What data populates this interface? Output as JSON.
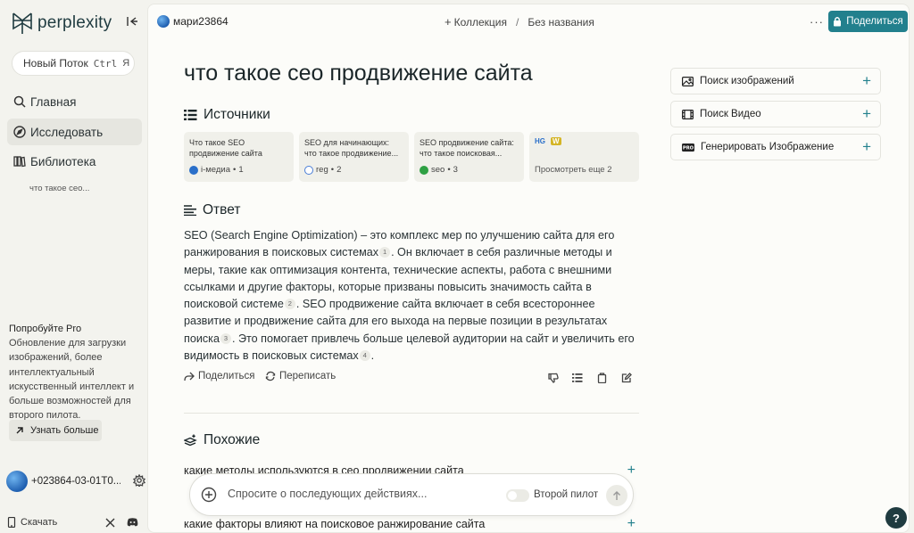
{
  "brand": {
    "name": "perplexity"
  },
  "sidebar": {
    "new_thread": {
      "label": "Новый Поток",
      "kbd1": "Ctrl",
      "kbd2": "Я"
    },
    "nav": [
      {
        "label": "Главная",
        "icon": "search-icon"
      },
      {
        "label": "Исследовать",
        "icon": "compass-icon"
      },
      {
        "label": "Библиотека",
        "icon": "library-icon"
      }
    ],
    "library_item": "что такое сео...",
    "promo": {
      "title": "Попробуйте Pro",
      "text": "Обновление для загрузки изображений, более интеллектуальный искусственный интеллект и больше возможностей для второго пилота.",
      "button": "Узнать больше"
    },
    "user": "+023864-03-01T0...",
    "download": "Скачать"
  },
  "topbar": {
    "user": "мари23864",
    "collection": "Коллекция",
    "separator": "/",
    "thread_name": "Без названия",
    "more": "···",
    "share": "Поделиться"
  },
  "thread": {
    "question": "что такое сео продвижение сайта",
    "sources_heading": "Источники",
    "sources": [
      {
        "title": "Что такое SEO продвижение сайта",
        "site": "i-медиа",
        "num": "1",
        "fav_color": "#2a6fc9"
      },
      {
        "title": "SEO для начинающих: что такое продвижение...",
        "site": "reg",
        "num": "2",
        "fav_color": "#4a7ed6"
      },
      {
        "title": "SEO продвижение сайта: что такое поисковая...",
        "site": "seo",
        "num": "3",
        "fav_color": "#2ea043"
      }
    ],
    "more_sources": {
      "label": "Просмотреть еще 2",
      "badge1": "HG",
      "badge2": "W"
    },
    "answer_heading": "Ответ",
    "answer": [
      {
        "t": "SEO (Search Engine Optimization) – это комплекс мер по улучшению сайта для его ранжирования в поисковых системах",
        "c": "1"
      },
      {
        "t": ". Он включает в себя различные методы и меры, такие как оптимизация контента, технические аспекты, работа с внешними ссылками и другие факторы, которые призваны повысить значимость сайта в поисковой системе",
        "c": "2"
      },
      {
        "t": ". SEO продвижение сайта включает в себя всестороннее развитие и продвижение сайта для его выхода на первые позиции в результатах поиска",
        "c": "3"
      },
      {
        "t": ". Это помогает привлечь больше целевой аудитории на сайт и увеличить его видимость в поисковых системах",
        "c": "4"
      },
      {
        "t": ".",
        "c": null
      }
    ],
    "actions": {
      "share": "Поделиться",
      "rewrite": "Переписать"
    },
    "related_heading": "Похожие",
    "related": [
      "какие методы используются в сео продвижении сайта",
      "какие факторы влияют на поисковое ранжирование сайта"
    ]
  },
  "followup": {
    "placeholder": "Спросите о последующих действиях...",
    "copilot": "Второй пилот"
  },
  "side_panel": [
    {
      "label": "Поиск изображений",
      "icon": "image-icon"
    },
    {
      "label": "Поиск Видео",
      "icon": "video-icon"
    },
    {
      "label": "Генерировать Изображение",
      "icon": "pro-badge-icon"
    }
  ],
  "colors": {
    "accent": "#22808d",
    "background": "#f3f3ee",
    "panel": "#fcfcf9"
  }
}
